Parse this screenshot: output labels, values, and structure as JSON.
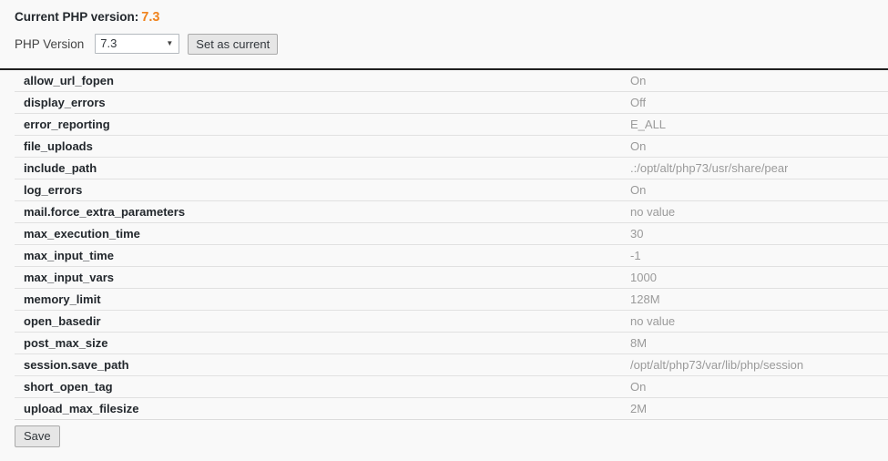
{
  "header": {
    "current_version_label": "Current PHP version:",
    "current_version_value": "7.3",
    "php_version_label": "PHP Version",
    "selected_version": "7.3",
    "version_options": [
      "7.3"
    ],
    "dropdown_arrow_icon": "▼",
    "set_as_current_label": "Set as current",
    "accent_color": "#f0831d"
  },
  "settings": {
    "rows": [
      {
        "name": "allow_url_fopen",
        "value": "On"
      },
      {
        "name": "display_errors",
        "value": "Off"
      },
      {
        "name": "error_reporting",
        "value": "E_ALL"
      },
      {
        "name": "file_uploads",
        "value": "On"
      },
      {
        "name": "include_path",
        "value": ".:/opt/alt/php73/usr/share/pear"
      },
      {
        "name": "log_errors",
        "value": "On"
      },
      {
        "name": "mail.force_extra_parameters",
        "value": "no value"
      },
      {
        "name": "max_execution_time",
        "value": "30"
      },
      {
        "name": "max_input_time",
        "value": "-1"
      },
      {
        "name": "max_input_vars",
        "value": "1000"
      },
      {
        "name": "memory_limit",
        "value": "128M"
      },
      {
        "name": "open_basedir",
        "value": "no value"
      },
      {
        "name": "post_max_size",
        "value": "8M"
      },
      {
        "name": "session.save_path",
        "value": "/opt/alt/php73/var/lib/php/session"
      },
      {
        "name": "short_open_tag",
        "value": "On"
      },
      {
        "name": "upload_max_filesize",
        "value": "2M"
      }
    ]
  },
  "footer": {
    "save_label": "Save"
  }
}
